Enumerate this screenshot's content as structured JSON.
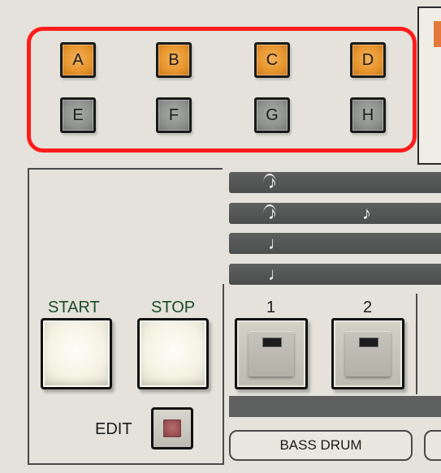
{
  "pattern_bank": {
    "buttons": [
      {
        "label": "A",
        "active": true
      },
      {
        "label": "B",
        "active": true
      },
      {
        "label": "C",
        "active": true
      },
      {
        "label": "D",
        "active": true
      },
      {
        "label": "E",
        "active": false
      },
      {
        "label": "F",
        "active": false
      },
      {
        "label": "G",
        "active": false
      },
      {
        "label": "H",
        "active": false
      }
    ],
    "highlight_color": "#ff1c1c"
  },
  "tempo_rows": [
    {
      "notes": [
        "♪"
      ],
      "tied": true
    },
    {
      "notes": [
        "♪",
        "♪"
      ],
      "tied": true
    },
    {
      "notes": [
        "♩"
      ],
      "tied": false
    },
    {
      "notes": [
        "♩"
      ],
      "tied": false
    }
  ],
  "transport": {
    "start_label": "START",
    "stop_label": "STOP",
    "edit_label": "EDIT"
  },
  "steps": [
    {
      "number": "1"
    },
    {
      "number": "2"
    }
  ],
  "instrument": {
    "label": "BASS DRUM"
  },
  "colors": {
    "active_orange": "#e8962e",
    "inactive_gray": "#8f918e",
    "label_green": "#1e4a2b",
    "edit_led": "#8a3f42"
  }
}
